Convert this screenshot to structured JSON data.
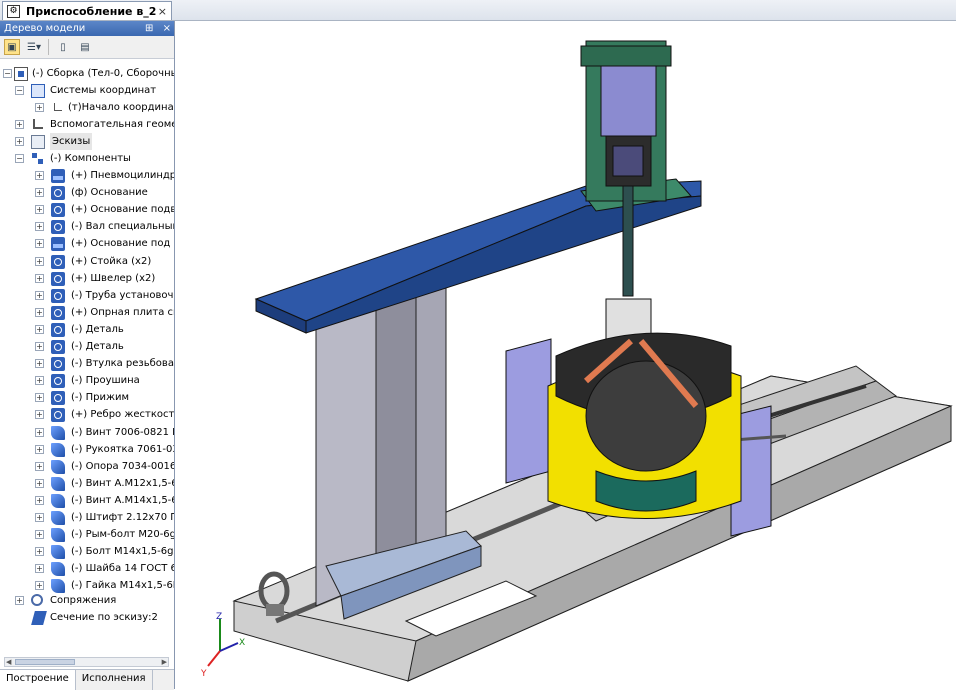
{
  "document_tab": {
    "title": "Приспособление в_2",
    "close": "×"
  },
  "panel": {
    "title": "Дерево модели",
    "pin": "⊞",
    "close": "×"
  },
  "tree": {
    "root": "(-) Сборка (Тел-0, Сборочных е",
    "coord_systems": "Системы координат",
    "origin": "(т)Начало координат",
    "aux_geometry": "Вспомогательная геометри",
    "sketches": "Эскизы",
    "components": "(-) Компоненты",
    "items": [
      "(+) Пневмоцилиндр",
      "(ф) Основание",
      "(+) Основание подвиж",
      "(-) Вал специальный",
      "(+) Основание под пне",
      "(+) Стойка (x2)",
      "(+) Швелер (x2)",
      "(-) Труба установочна:",
      "(+) Опрная плита специ",
      "(-) Деталь",
      "(-) Деталь",
      "(-) Втулка резьбовая",
      "(-) Проушина",
      "(-) Прижим",
      "(+) Ребро жесткости",
      "(-) Винт 7006-0821 К7 I",
      "(-) Рукоятка 7061-033",
      "(-) Опора 7034-0016 ГС",
      "(-) Винт А.М12х1,5-6gх",
      "(-) Винт А.М14х1,5-6gх",
      "(-) Штифт 2.12х70 ГОС",
      "(-) Рым-болт М20-6g ГС",
      "(-) Болт М14х1,5-6gх7(",
      "(-) Шайба 14 ГОСТ 64(",
      "(-) Гайка М14х1,5-6Н ("
    ],
    "mates": "Сопряжения",
    "section": "Сечение по эскизу:2"
  },
  "bottom_tabs": [
    "Построение",
    "Исполнения"
  ],
  "axes": {
    "x": "X",
    "y": "Y",
    "z": "Z"
  },
  "colors": {
    "accent": "#3b68b0",
    "beam_blue": "#2e58a8",
    "yellow": "#f2e000",
    "lavender": "#9c9ce0",
    "gray": "#c8c8c8"
  }
}
